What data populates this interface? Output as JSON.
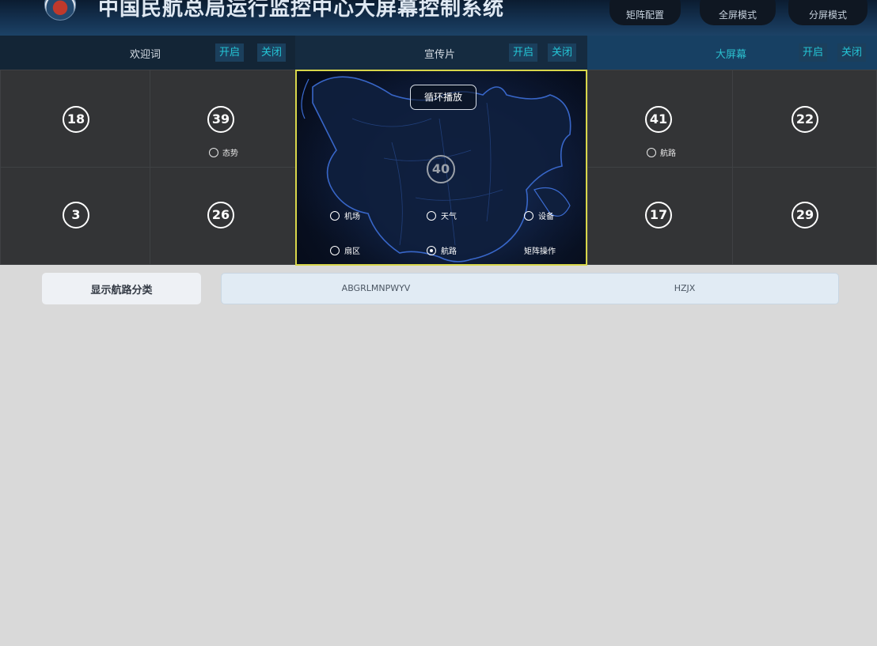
{
  "header": {
    "title": "中国民航总局运行监控中心大屏幕控制系统",
    "buttons": [
      "矩阵配置",
      "全屏模式",
      "分屏模式"
    ]
  },
  "controls": {
    "welcome": {
      "label": "欢迎词",
      "on": "开启",
      "off": "关闭"
    },
    "promo": {
      "label": "宣传片",
      "on": "开启",
      "off": "关闭"
    },
    "screen": {
      "label": "大屏幕",
      "on": "开启",
      "off": "关闭"
    }
  },
  "tiles": {
    "t18": {
      "num": "18"
    },
    "t39": {
      "num": "39",
      "option": "态势"
    },
    "t41": {
      "num": "41",
      "option": "航路"
    },
    "t22": {
      "num": "22"
    },
    "t3": {
      "num": "3"
    },
    "t26": {
      "num": "26"
    },
    "t17": {
      "num": "17"
    },
    "t29": {
      "num": "29"
    }
  },
  "map_tile": {
    "loop_label": "循环播放",
    "num": "40",
    "options": [
      {
        "label": "机场",
        "checked": false
      },
      {
        "label": "天气",
        "checked": false
      },
      {
        "label": "设备",
        "checked": false
      },
      {
        "label": "扇区",
        "checked": false
      },
      {
        "label": "航路",
        "checked": true
      }
    ],
    "matrix_op": "矩阵操作"
  },
  "routes": {
    "button_label": "显示航路分类",
    "items": [
      "ABGRLMNPWYV",
      "HZJX"
    ]
  },
  "colors": {
    "accent": "#24c6d6",
    "highlight_border": "#d8d64a",
    "tile_bg": "#333436",
    "page_bg": "#d9d9d9"
  }
}
